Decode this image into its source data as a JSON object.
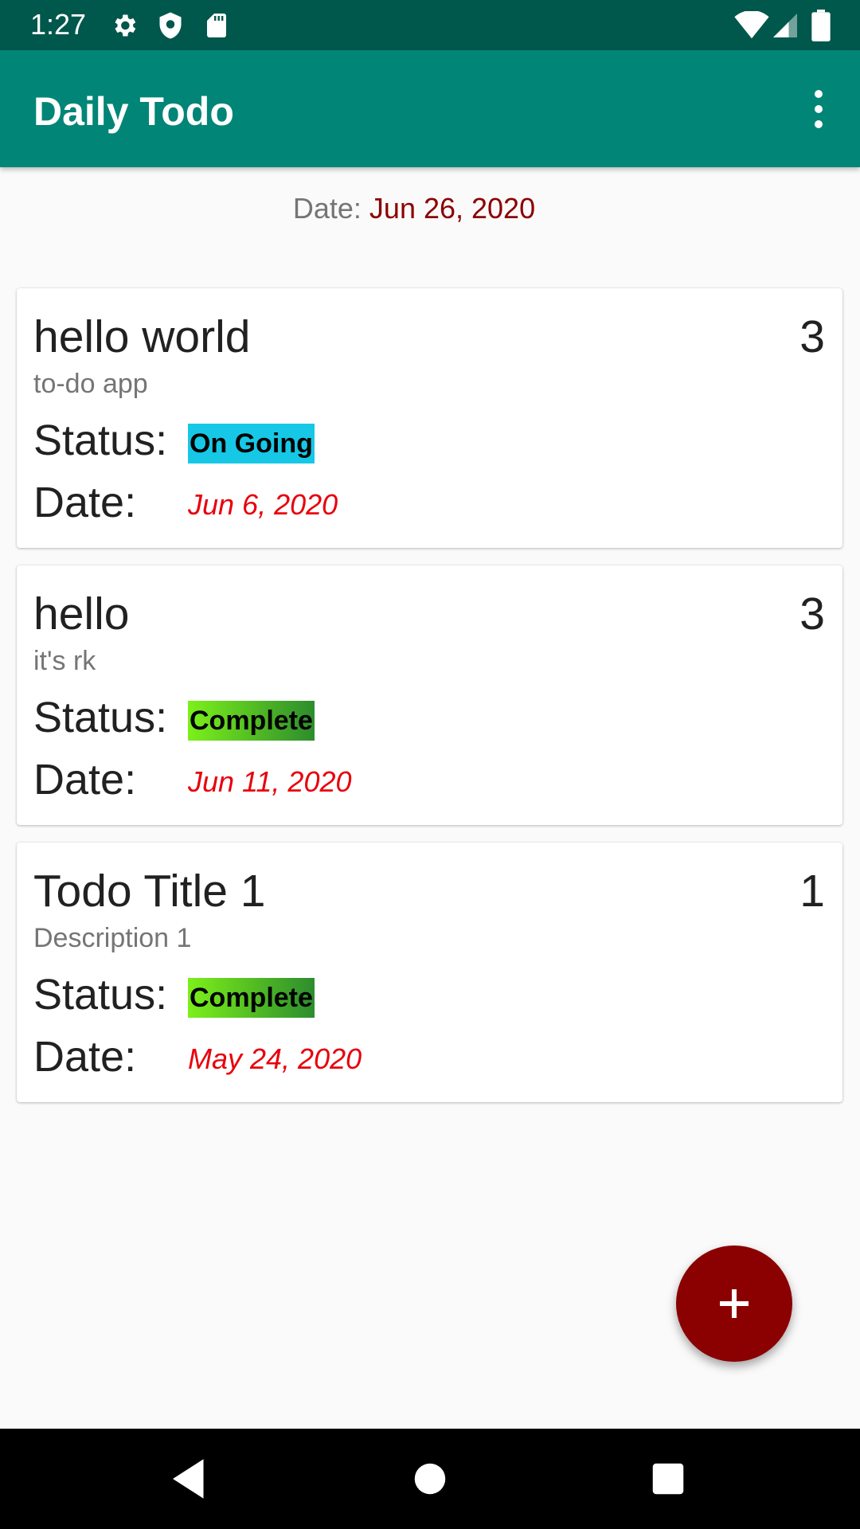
{
  "status_bar": {
    "time": "1:27",
    "icons_left": [
      "settings-icon",
      "shield-icon",
      "sd-card-icon"
    ],
    "icons_right": [
      "wifi-icon",
      "signal-icon",
      "battery-icon"
    ]
  },
  "app_bar": {
    "title": "Daily Todo",
    "menu_icon": "more-vert-icon"
  },
  "header": {
    "date_label": "Date: ",
    "date_value": "Jun 26, 2020"
  },
  "todos": [
    {
      "title": "hello world",
      "count": "3",
      "description": "to-do app",
      "status_label": "Status:",
      "status": "On Going",
      "date_label": "Date:",
      "date": "Jun 6, 2020"
    },
    {
      "title": "hello",
      "count": "3",
      "description": "it's rk",
      "status_label": "Status:",
      "status": "Complete",
      "date_label": "Date:",
      "date": "Jun 11, 2020"
    },
    {
      "title": "Todo Title 1",
      "count": "1",
      "description": "Description 1",
      "status_label": "Status:",
      "status": "Complete",
      "date_label": "Date:",
      "date": "May 24, 2020"
    }
  ],
  "fab": {
    "icon": "add-icon"
  },
  "nav_bar": {
    "buttons": [
      "back-icon",
      "home-icon",
      "recents-icon"
    ]
  },
  "colors": {
    "status_bar": "#00574b",
    "app_bar": "#008577",
    "accent": "#8b0000",
    "date_text": "#e8000b",
    "ongoing": "#16c8e6",
    "complete_start": "#7cf01a",
    "complete_end": "#2d8c2d"
  }
}
